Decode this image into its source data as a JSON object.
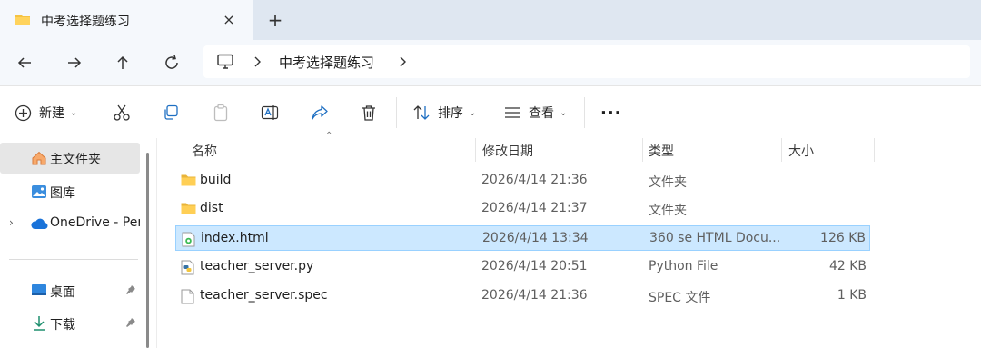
{
  "tab": {
    "title": "中考选择题练习",
    "close_icon": "×",
    "new_tab_icon": "+"
  },
  "address": {
    "breadcrumb": "中考选择题练习"
  },
  "commands": {
    "new_label": "新建",
    "sort_label": "排序",
    "view_label": "查看",
    "more_label": "···"
  },
  "nav": {
    "items": [
      {
        "label": "主文件夹"
      },
      {
        "label": "图库"
      },
      {
        "label": "OneDrive - Per"
      },
      {
        "label": "桌面"
      },
      {
        "label": "下载"
      }
    ]
  },
  "columns": {
    "name": "名称",
    "date": "修改日期",
    "type": "类型",
    "size": "大小"
  },
  "files": [
    {
      "name": "build",
      "date": "2026/4/14 21:36",
      "type": "文件夹",
      "size": ""
    },
    {
      "name": "dist",
      "date": "2026/4/14 21:37",
      "type": "文件夹",
      "size": ""
    },
    {
      "name": "index.html",
      "date": "2026/4/14 13:34",
      "type": "360 se HTML Docu...",
      "size": "126 KB"
    },
    {
      "name": "teacher_server.py",
      "date": "2026/4/14 20:51",
      "type": "Python File",
      "size": "42 KB"
    },
    {
      "name": "teacher_server.spec",
      "date": "2026/4/14 21:36",
      "type": "SPEC 文件",
      "size": "1 KB"
    }
  ],
  "colors": {
    "selection_bg": "#cce8ff",
    "selection_border": "#99d1ff",
    "folder": "#f5c342",
    "tabstrip": "#dfe7f1"
  }
}
